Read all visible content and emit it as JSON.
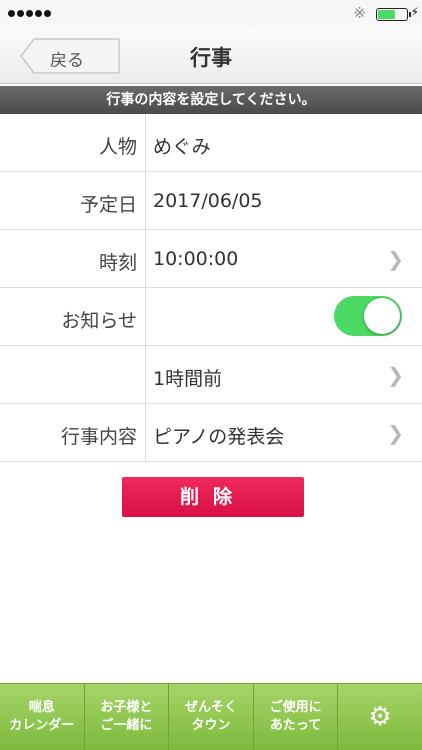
{
  "status": {
    "signal_dots": 5,
    "bluetooth_icon": "bluetooth-icon",
    "battery_level": 0.55,
    "battery_color": "#4cd964"
  },
  "nav": {
    "back_label": "戻る",
    "title": "行事"
  },
  "banner": "行事の内容を設定してください。",
  "form": {
    "person": {
      "label": "人物",
      "value": "めぐみ"
    },
    "date": {
      "label": "予定日",
      "value": "2017/06/05"
    },
    "time": {
      "label": "時刻",
      "value": "10:00:00"
    },
    "notify": {
      "label": "お知らせ",
      "enabled": true,
      "timing": "1時間前"
    },
    "content": {
      "label": "行事内容",
      "value": "ピアノの発表会"
    }
  },
  "delete_label": "削除",
  "tabs": [
    {
      "line1": "喘息",
      "line2": "カレンダー"
    },
    {
      "line1": "お子様と",
      "line2": "ご一緒に"
    },
    {
      "line1": "ぜんそく",
      "line2": "タウン"
    },
    {
      "line1": "ご使用に",
      "line2": "あたって"
    },
    {
      "icon": "gear-icon"
    }
  ],
  "colors": {
    "accent_green": "#7cbb3c",
    "delete_red": "#e0164c",
    "toggle_on": "#4cd964"
  }
}
